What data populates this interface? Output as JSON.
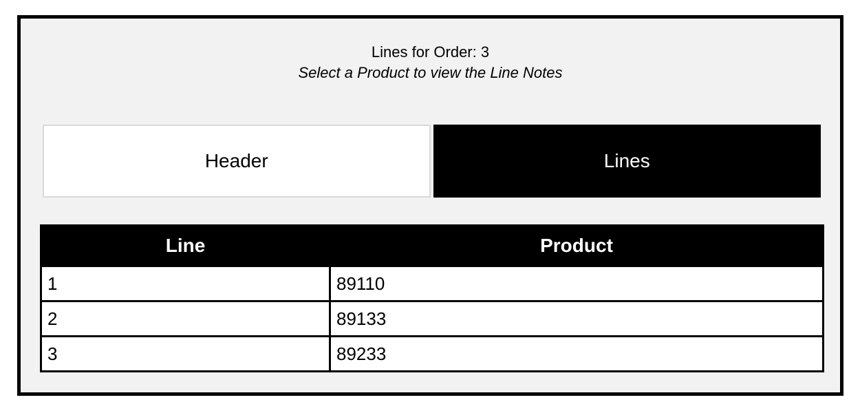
{
  "header": {
    "title": "Lines for Order: 3",
    "subtitle": "Select a Product to view the Line Notes"
  },
  "tabs": [
    {
      "label": "Header",
      "active": false
    },
    {
      "label": "Lines",
      "active": true
    }
  ],
  "table": {
    "columns": [
      "Line",
      "Product"
    ],
    "rows": [
      {
        "line": "1",
        "product": "89110"
      },
      {
        "line": "2",
        "product": "89133"
      },
      {
        "line": "3",
        "product": "89233"
      }
    ]
  },
  "colors": {
    "frame_border": "#000000",
    "panel_background": "#f2f2f2",
    "active_tab": "#000000",
    "inactive_tab": "#ffffff"
  }
}
